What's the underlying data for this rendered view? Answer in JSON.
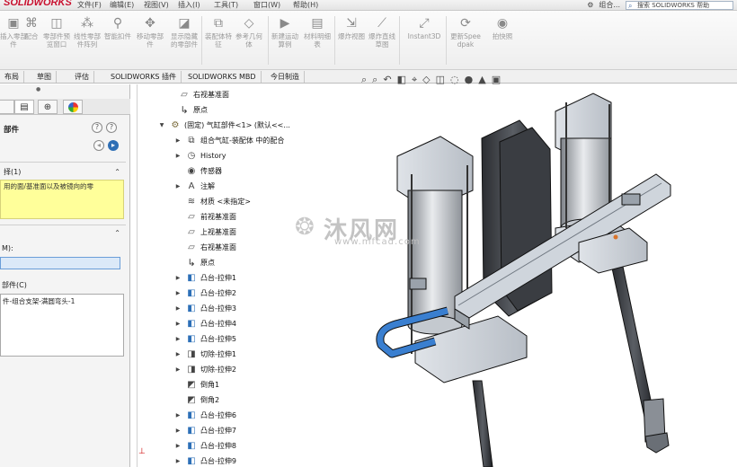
{
  "app": {
    "logo": "SOLIDWORKS",
    "menus": [
      "文件(F)",
      "编辑(E)",
      "视图(V)",
      "插入(I)",
      "工具(T)",
      "窗口(W)",
      "帮助(H)"
    ],
    "doc_title": "组合...",
    "search_placeholder": "搜索 SOLIDWORKS 帮助"
  },
  "ribbon": {
    "buttons": [
      {
        "label": "插入零部件",
        "icon": "insert-component-icon"
      },
      {
        "label": "配合",
        "icon": "mate-icon"
      },
      {
        "label": "零部件预览窗口",
        "icon": "component-preview-icon"
      },
      {
        "label": "线性零部件阵列",
        "icon": "linear-pattern-icon"
      },
      {
        "label": "智能扣件",
        "icon": "smart-fasteners-icon"
      },
      {
        "label": "移动零部件",
        "icon": "move-component-icon"
      },
      {
        "label": "显示隐藏的零部件",
        "icon": "show-hidden-icon"
      },
      {
        "label": "装配体特征",
        "icon": "assembly-feature-icon"
      },
      {
        "label": "参考几何体",
        "icon": "reference-geometry-icon"
      },
      {
        "label": "新建运动算例",
        "icon": "motion-study-icon"
      },
      {
        "label": "材料明细表",
        "icon": "bom-icon"
      },
      {
        "label": "爆炸视图",
        "icon": "exploded-view-icon"
      },
      {
        "label": "爆炸直线草图",
        "icon": "explode-line-icon"
      },
      {
        "label": "Instant3D",
        "icon": "instant3d-icon"
      },
      {
        "label": "更新Speedpak",
        "icon": "speedpak-icon"
      },
      {
        "label": "拍快照",
        "icon": "snapshot-icon"
      }
    ]
  },
  "tabs": [
    "布局",
    "草图",
    "评估",
    "SOLIDWORKS 插件",
    "SOLIDWORKS MBD",
    "今日制造"
  ],
  "property_manager": {
    "title": "部件",
    "section1_title": "择(1)",
    "note": "用的面/基准面以及被镜向的零",
    "section2_label": "M):",
    "parts_label": "部件(C)",
    "list_item": "件-组合支架-满圆弯头-1"
  },
  "tree": [
    {
      "label": "右视基准面",
      "icon": "plane",
      "exp": false
    },
    {
      "label": "原点",
      "icon": "origin",
      "exp": false
    },
    {
      "label": "(固定) 气缸部件<1> (默认<<...",
      "icon": "asm",
      "exp": true,
      "indent": -10
    },
    {
      "label": "组合气缸-装配体 中的配合",
      "icon": "mates",
      "exp": true
    },
    {
      "label": "History",
      "icon": "history",
      "exp": true
    },
    {
      "label": "传感器",
      "icon": "sensor",
      "exp": false
    },
    {
      "label": "注解",
      "icon": "annotation",
      "exp": true
    },
    {
      "label": "材质 <未指定>",
      "icon": "material",
      "exp": false
    },
    {
      "label": "前视基准面",
      "icon": "plane",
      "exp": false
    },
    {
      "label": "上视基准面",
      "icon": "plane",
      "exp": false
    },
    {
      "label": "右视基准面",
      "icon": "plane",
      "exp": false
    },
    {
      "label": "原点",
      "icon": "origin",
      "exp": false
    },
    {
      "label": "凸台-拉伸1",
      "icon": "feature",
      "exp": true
    },
    {
      "label": "凸台-拉伸2",
      "icon": "feature",
      "exp": true
    },
    {
      "label": "凸台-拉伸3",
      "icon": "feature",
      "exp": true
    },
    {
      "label": "凸台-拉伸4",
      "icon": "feature",
      "exp": true
    },
    {
      "label": "凸台-拉伸5",
      "icon": "feature",
      "exp": true
    },
    {
      "label": "切除-拉伸1",
      "icon": "cut",
      "exp": true
    },
    {
      "label": "切除-拉伸2",
      "icon": "cut",
      "exp": true
    },
    {
      "label": "倒角1",
      "icon": "chamfer",
      "exp": false
    },
    {
      "label": "倒角2",
      "icon": "chamfer",
      "exp": false
    },
    {
      "label": "凸台-拉伸6",
      "icon": "feature",
      "exp": true
    },
    {
      "label": "凸台-拉伸7",
      "icon": "feature",
      "exp": true
    },
    {
      "label": "凸台-拉伸8",
      "icon": "feature",
      "exp": true
    },
    {
      "label": "凸台-拉伸9",
      "icon": "feature",
      "exp": true
    }
  ],
  "watermark": {
    "main": "沐风网",
    "sub": "www.mfcad.com"
  }
}
